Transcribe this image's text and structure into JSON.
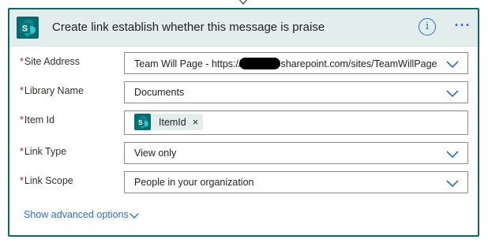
{
  "header": {
    "title": "Create link establish whether this message is praise",
    "info_icon": "info-icon",
    "more_icon": "more-options-icon",
    "info_glyph": "i",
    "more_glyph": "···"
  },
  "fields": [
    {
      "label": "Site Address",
      "required": true,
      "value_prefix": "Team Will Page - https://",
      "value_suffix": "sharepoint.com/sites/TeamWillPage",
      "type": "dropdown"
    },
    {
      "label": "Library Name",
      "required": true,
      "value": "Documents",
      "type": "dropdown"
    },
    {
      "label": "Item Id",
      "required": true,
      "token_label": "ItemId",
      "token_close": "×",
      "type": "token-input"
    },
    {
      "label": "Link Type",
      "required": true,
      "value": "View only",
      "type": "dropdown"
    },
    {
      "label": "Link Scope",
      "required": true,
      "value": "People in your organization",
      "type": "dropdown"
    }
  ],
  "required_marker": "*",
  "advanced_options_label": "Show advanced options",
  "colors": {
    "accent": "#2b6cd8",
    "brand_teal": "#036c70",
    "border": "#0b6a66",
    "header_bg": "#e3edec",
    "required": "#a4262c"
  }
}
